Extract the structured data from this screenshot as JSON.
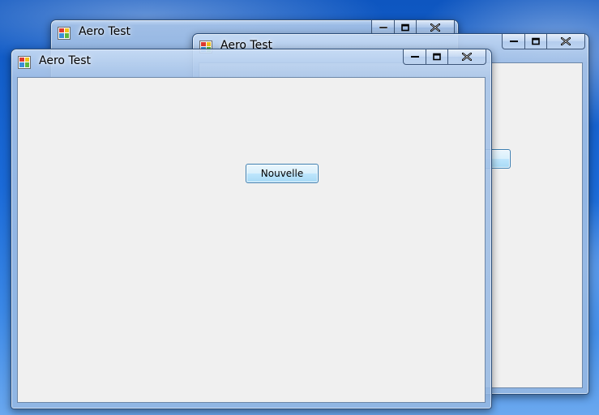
{
  "windows": [
    {
      "title": "Aero Test",
      "buttons": {
        "minimize": "minimize",
        "maximize": "maximize",
        "close": "close"
      }
    },
    {
      "title": "Aero Test",
      "buttons": {
        "minimize": "minimize",
        "maximize": "maximize",
        "close": "close"
      }
    },
    {
      "title": "Aero Test",
      "button_label": "Nouvelle",
      "buttons": {
        "minimize": "minimize",
        "maximize": "maximize",
        "close": "close"
      }
    }
  ],
  "icons": {
    "app": "winforms-app-icon",
    "minimize": "minimize-icon",
    "maximize": "maximize-icon",
    "close": "close-icon"
  },
  "colors": {
    "desktop": "#1a6ad8",
    "client_area": "#f0f0f0",
    "button_border": "#3c7fb1",
    "frame_border": "#2c4e7a"
  }
}
